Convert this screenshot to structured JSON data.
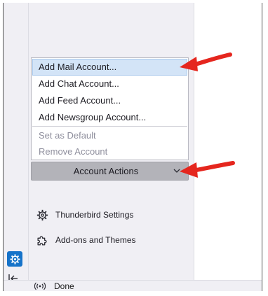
{
  "menu": {
    "items": [
      {
        "label": "Add Mail Account...",
        "enabled": true,
        "highlighted": true
      },
      {
        "label": "Add Chat Account...",
        "enabled": true,
        "highlighted": false
      },
      {
        "label": "Add Feed Account...",
        "enabled": true,
        "highlighted": false
      },
      {
        "label": "Add Newsgroup Account...",
        "enabled": true,
        "highlighted": false
      }
    ],
    "secondary_items": [
      {
        "label": "Set as Default",
        "enabled": false
      },
      {
        "label": "Remove Account",
        "enabled": false
      }
    ]
  },
  "account_actions": {
    "label": "Account Actions",
    "icon": "chevron-down-icon"
  },
  "settings_links": [
    {
      "label": "Thunderbird Settings",
      "icon": "gear-icon"
    },
    {
      "label": "Add-ons and Themes",
      "icon": "puzzle-icon"
    }
  ],
  "spaces": {
    "active_icon": "gear-icon",
    "collapse_icon": "collapse-left-icon"
  },
  "status": {
    "text": "Done",
    "icon": "broadcast-icon"
  },
  "annotations": {
    "arrow_color": "#e5261e"
  },
  "colors": {
    "highlight": "#d3e4f7",
    "accent": "#1673c9",
    "button": "#b3b3b9"
  }
}
